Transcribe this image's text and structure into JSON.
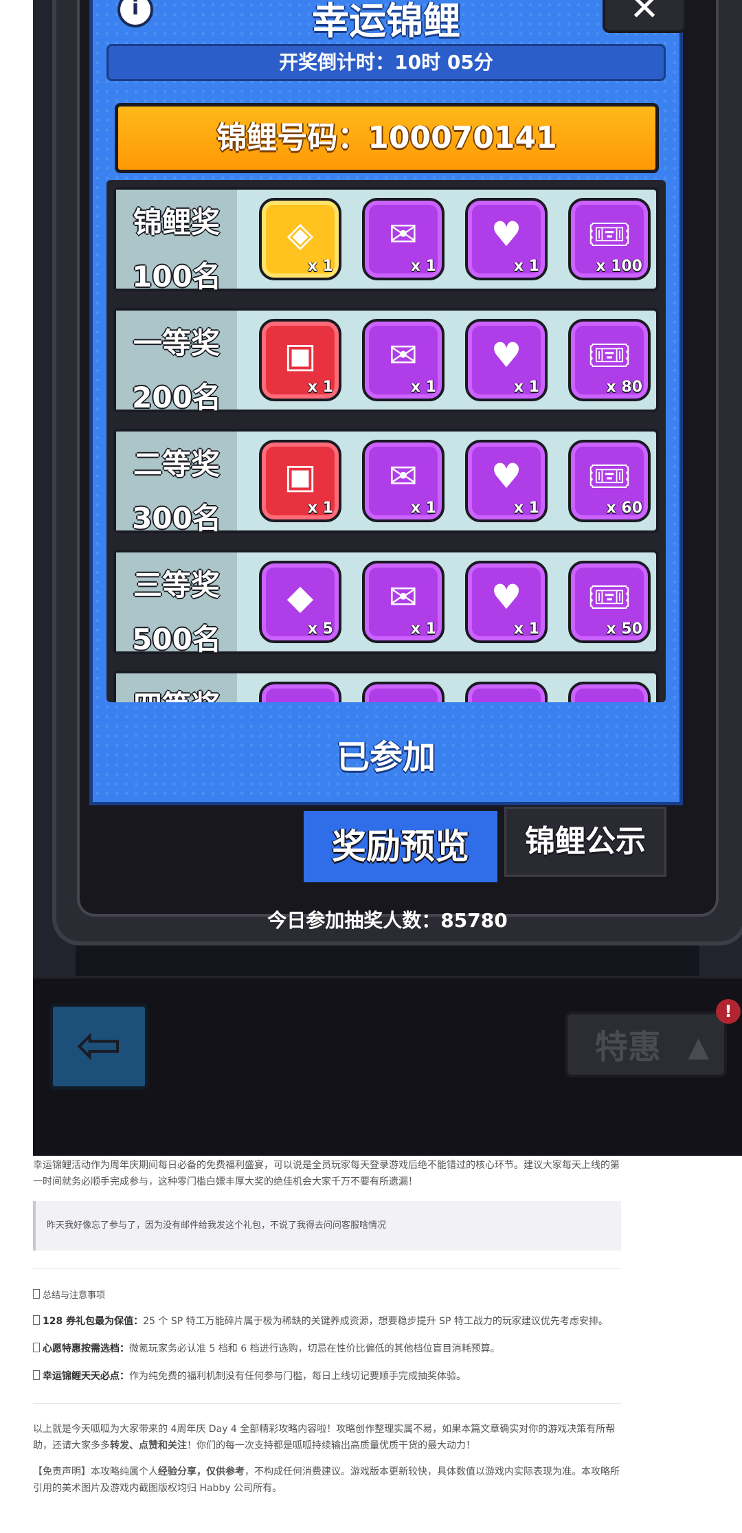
{
  "game": {
    "modal_title": "幸运锦鲤",
    "info_icon": "i",
    "close_label": "✕",
    "countdown": "开奖倒计时：10时 05分",
    "koi_number": "锦鲤号码：100070141",
    "prizes": [
      {
        "title": "锦鲤奖",
        "count": "100名",
        "items": [
          {
            "kind": "gold",
            "icon": "treasure-chest-icon",
            "glyph": "◈",
            "qty": "x 1"
          },
          {
            "kind": "purple",
            "icon": "heart-envelope-icon",
            "glyph": "✉",
            "qty": "x 1"
          },
          {
            "kind": "purple",
            "icon": "heart-card-icon",
            "glyph": "♥",
            "qty": "x 1"
          },
          {
            "kind": "purple",
            "icon": "ticket-icon",
            "glyph": "🎟",
            "qty": "x 100"
          }
        ]
      },
      {
        "title": "一等奖",
        "count": "200名",
        "items": [
          {
            "kind": "red",
            "icon": "red-chest-icon",
            "glyph": "▣",
            "qty": "x 1"
          },
          {
            "kind": "purple",
            "icon": "heart-envelope-icon",
            "glyph": "✉",
            "qty": "x 1"
          },
          {
            "kind": "purple",
            "icon": "heart-card-icon",
            "glyph": "♥",
            "qty": "x 1"
          },
          {
            "kind": "purple",
            "icon": "ticket-icon",
            "glyph": "🎟",
            "qty": "x 80"
          }
        ]
      },
      {
        "title": "二等奖",
        "count": "300名",
        "items": [
          {
            "kind": "red",
            "icon": "red-chest-icon",
            "glyph": "▣",
            "qty": "x 1"
          },
          {
            "kind": "purple",
            "icon": "heart-envelope-icon",
            "glyph": "✉",
            "qty": "x 1"
          },
          {
            "kind": "purple",
            "icon": "heart-card-icon",
            "glyph": "♥",
            "qty": "x 1"
          },
          {
            "kind": "purple",
            "icon": "ticket-icon",
            "glyph": "🎟",
            "qty": "x 60"
          }
        ]
      },
      {
        "title": "三等奖",
        "count": "500名",
        "items": [
          {
            "kind": "purple",
            "icon": "gem-icon",
            "glyph": "◆",
            "qty": "x 5"
          },
          {
            "kind": "purple",
            "icon": "heart-envelope-icon",
            "glyph": "✉",
            "qty": "x 1"
          },
          {
            "kind": "purple",
            "icon": "heart-card-icon",
            "glyph": "♥",
            "qty": "x 1"
          },
          {
            "kind": "purple",
            "icon": "ticket-icon",
            "glyph": "🎟",
            "qty": "x 50"
          }
        ]
      },
      {
        "title": "四等奖",
        "count": "",
        "items": [
          {
            "kind": "purple",
            "icon": "item-icon",
            "glyph": "",
            "qty": ""
          },
          {
            "kind": "purple",
            "icon": "item-icon",
            "glyph": "",
            "qty": ""
          },
          {
            "kind": "purple",
            "icon": "item-icon",
            "glyph": "",
            "qty": ""
          },
          {
            "kind": "purple",
            "icon": "item-icon",
            "glyph": "",
            "qty": ""
          }
        ]
      }
    ],
    "joined_label": "已参加",
    "tab_preview": "奖励预览",
    "tab_announce": "锦鲤公示",
    "participants": "今日参加抽奖人数：85780",
    "back_icon": "⇦",
    "special_label": "特惠",
    "special_arrow": "▲",
    "badge": "!"
  },
  "article": {
    "p1": "幸运锦鲤活动作为周年庆期间每日必备的免费福利盛宴，可以说是全员玩家每天登录游戏后绝不能错过的核心环节。建议大家每天上线的第一时间就务必顺手完成参与，这种零门槛白嫖丰厚大奖的绝佳机会大家千万不要有所遗漏！",
    "quote": "昨天我好像忘了参与了，因为没有邮件给我发这个礼包，不说了我得去问问客服啥情况",
    "section_title": "总结与注意事项",
    "bullets": [
      {
        "bold": "128 券礼包最为保值：",
        "text": "25 个 SP 特工万能碎片属于极为稀缺的关键养成资源，想要稳步提升 SP 特工战力的玩家建议优先考虑安排。"
      },
      {
        "bold": "心愿特惠按需选档：",
        "text": "微氪玩家务必认准 5 档和 6 档进行选购，切忌在性价比偏低的其他档位盲目消耗预算。"
      },
      {
        "bold": "幸运锦鲤天天必点：",
        "text": "作为纯免费的福利机制没有任何参与门槛，每日上线切记要顺手完成抽奖体验。"
      }
    ],
    "closing_a": "以上就是今天呱呱为大家带来的 4周年庆 Day 4 全部精彩攻略内容啦！攻略创作整理实属不易，如果本篇文章确实对你的游戏决策有所帮助，还请大家多多",
    "closing_b": "转发、点赞和关注",
    "closing_c": "！你们的每一次支持都是呱呱持续输出高质量优质干货的最大动力！",
    "disclaimer_a": "【免责声明】本攻略纯属个人",
    "disclaimer_b": "经验分享，仅供参考",
    "disclaimer_c": "，不构成任何消费建议。游戏版本更新较快，具体数值以游戏内实际表现为准。本攻略所引用的美术图片及游戏内截图版权均归 Habby 公司所有。"
  },
  "colors": {
    "modal_blue": "#3b82f0",
    "koi_orange": "#ff9a05",
    "prize_purple": "#b03ee8",
    "prize_red": "#e8323f",
    "prize_gold": "#ffc21e"
  }
}
